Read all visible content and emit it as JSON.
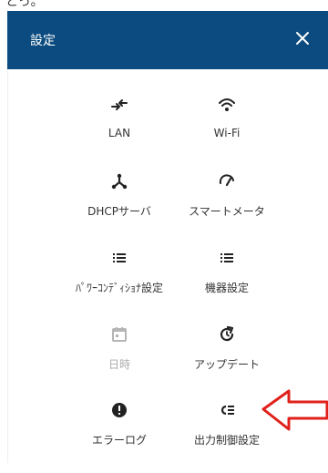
{
  "top_fragment": "とっ。",
  "header": {
    "title": "設定",
    "close_icon": "close-icon"
  },
  "items": [
    {
      "key": "lan",
      "label": "LAN",
      "icon": "lan-arrows-icon",
      "enabled": true
    },
    {
      "key": "wifi",
      "label": "Wi-Fi",
      "icon": "wifi-icon",
      "enabled": true
    },
    {
      "key": "dhcp",
      "label": "DHCPサーバ",
      "icon": "network-hub-icon",
      "enabled": true
    },
    {
      "key": "smartmeter",
      "label": "スマートメータ",
      "icon": "gauge-icon",
      "enabled": true
    },
    {
      "key": "powercond",
      "label": "ﾊﾟﾜｰｺﾝﾃﾞｨｼｮﾅ設定",
      "icon": "list-icon",
      "enabled": true
    },
    {
      "key": "device",
      "label": "機器設定",
      "icon": "list-icon",
      "enabled": true
    },
    {
      "key": "datetime",
      "label": "日時",
      "icon": "calendar-icon",
      "enabled": false
    },
    {
      "key": "update",
      "label": "アップデート",
      "icon": "update-icon",
      "enabled": true
    },
    {
      "key": "errorlog",
      "label": "エラーログ",
      "icon": "error-icon",
      "enabled": true
    },
    {
      "key": "output",
      "label": "出力制御設定",
      "icon": "output-control-icon",
      "enabled": true
    }
  ],
  "colors": {
    "header_bg": "#0b4b7f",
    "icon": "#222222",
    "disabled_icon": "#b5b5b5",
    "annotation_arrow": "#e0201b"
  }
}
